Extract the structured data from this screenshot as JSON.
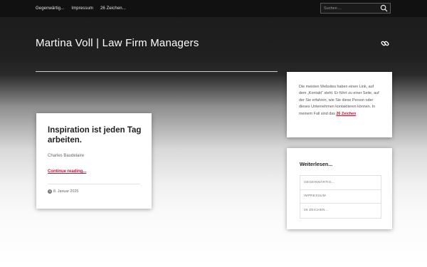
{
  "nav": {
    "items": [
      "Gegenwärtig...",
      "Impressum",
      "26 Zeichen..."
    ]
  },
  "search": {
    "placeholder": "Suchen ...",
    "icon": "search-icon"
  },
  "header": {
    "site_title": "Martina Voll | Law Firm Managers",
    "link_icon": "link-icon"
  },
  "post": {
    "title": "Inspiration ist jeden Tag arbeiten.",
    "author": "Charles Baudelaire",
    "more": "Continue reading...",
    "date": "8. Januar 2025"
  },
  "widget_text": {
    "body": "Die meisten Websites haben einen Link, auf dem „Kontakt“ steht. Er führt zu einer Seite, auf der Sie erfahren, wie Sie diese Person oder dieses Unternehmen kontaktieren können. In meinem Fall sind das ",
    "link": "26 Zeichen"
  },
  "widget_links": {
    "title": "Weiterlesen...",
    "items": [
      "GEGENWÄRTIG...",
      "IMPRESSUM",
      "26 ZEICHEN..."
    ]
  },
  "colors": {
    "accent": "#c8102e",
    "topbar": "#111111"
  }
}
